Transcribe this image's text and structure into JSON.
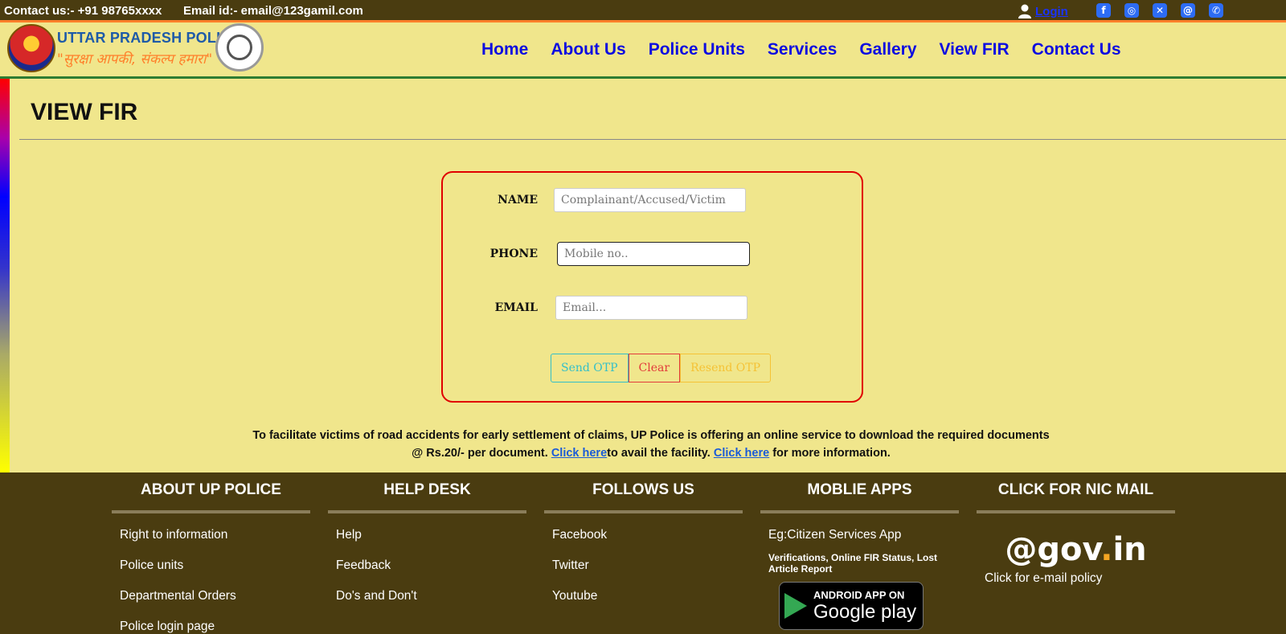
{
  "topbar": {
    "contact": "Contact us:- +91 98765xxxx",
    "email": "Email id:- email@123gamil.com",
    "login_label": "Login",
    "social_icons": [
      "facebook-icon",
      "instagram-icon",
      "x-icon",
      "threads-icon",
      "phone-icon"
    ]
  },
  "header": {
    "brand_title": "UTTAR PRADESH POLICE",
    "brand_tagline": "\"सुरक्षा आपकी, संकल्प हमारा\"",
    "nav": [
      "Home",
      "About Us",
      "Police Units",
      "Services",
      "Gallery",
      "View FIR",
      "Contact Us"
    ]
  },
  "page": {
    "title": "VIEW FIR"
  },
  "form": {
    "name_label": "NAME",
    "name_placeholder": "Complainant/Accused/Victim",
    "phone_label": "PHONE",
    "phone_placeholder": "Mobile no..",
    "email_label": "EMAIL",
    "email_placeholder": "Email...",
    "send_otp": "Send OTP",
    "clear": "Clear",
    "resend_otp": "Resend OTP"
  },
  "notice": {
    "text_1": "To facilitate victims of road accidents for early settlement of claims, UP Police is offering an online service to download the required documents @ Rs.20/- per document. ",
    "link_1": "Click here",
    "text_2": "to avail the facility. ",
    "link_2": "Click here",
    "text_3": " for more information."
  },
  "footer": {
    "about": {
      "title": "ABOUT UP POLICE",
      "items": [
        "Right to information",
        "Police units",
        "Departmental Orders",
        "Police login page"
      ]
    },
    "help": {
      "title": "HELP DESK",
      "items": [
        "Help",
        "Feedback",
        "Do's and Don't"
      ]
    },
    "follow": {
      "title": "FOLLOWS US",
      "items": [
        "Facebook",
        "Twitter",
        "Youtube"
      ]
    },
    "apps": {
      "title": "MOBLIE APPS",
      "app_name": "Eg:Citizen Services App",
      "app_desc": "Verifications, Online FIR Status, Lost Article Report",
      "play_small": "ANDROID APP ON",
      "play_big": "Google play"
    },
    "nic": {
      "title": "CLICK FOR NIC MAIL",
      "logo_text": "@gov",
      "logo_suffix": "in",
      "note": "Click for e-mail policy"
    }
  },
  "colors": {
    "background": "#f0e68c",
    "dark_band": "#4a3c10",
    "nav_link": "#0d0de0",
    "form_border": "#e00000"
  }
}
